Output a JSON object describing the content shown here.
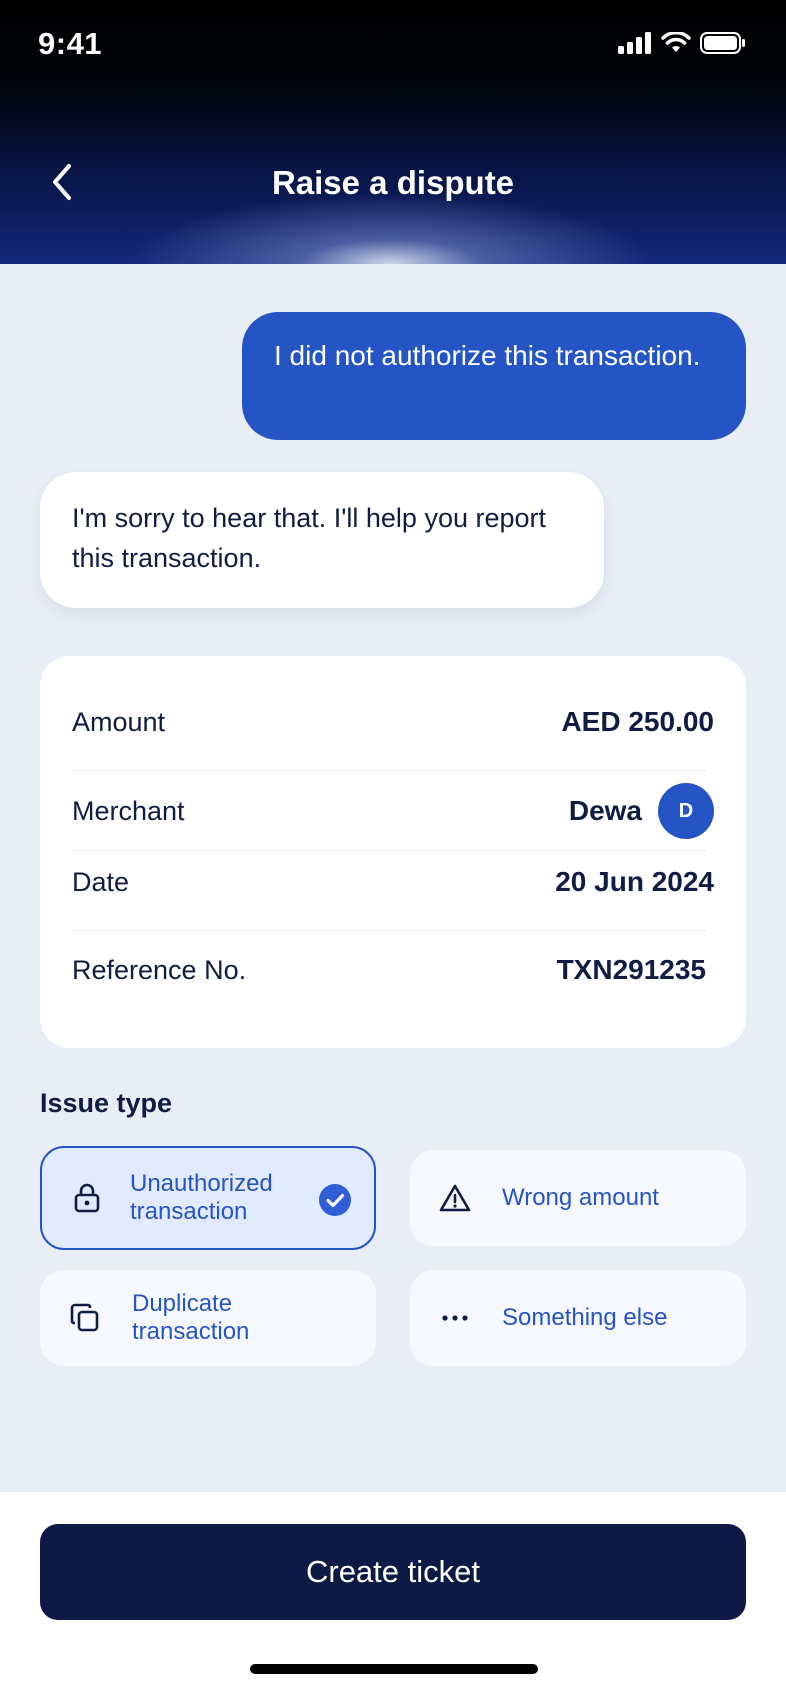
{
  "status_bar": {
    "time": "9:41"
  },
  "header": {
    "title": "Raise a dispute"
  },
  "chat": {
    "user_message": "I did not authorize this transaction.",
    "bot_message": "I'm sorry to hear that. I'll help you report this transaction."
  },
  "details": {
    "amount": {
      "label": "Amount",
      "value": "AED 250.00"
    },
    "merchant": {
      "label": "Merchant",
      "value": "Dewa",
      "avatar_letter": "D"
    },
    "date": {
      "label": "Date",
      "value": "20 Jun 2024"
    },
    "reference": {
      "label": "Reference No.",
      "value": "TXN291235"
    }
  },
  "issue_type": {
    "title": "Issue type",
    "options": [
      {
        "label": "Unauthorized\ntransaction",
        "icon": "lock-icon",
        "selected": true
      },
      {
        "label": "Wrong amount",
        "icon": "warning-icon",
        "selected": false
      },
      {
        "label": "Duplicate\ntransaction",
        "icon": "copy-icon",
        "selected": false
      },
      {
        "label": "Something else",
        "icon": "more-icon",
        "selected": false
      }
    ]
  },
  "cta": {
    "label": "Create ticket"
  },
  "colors": {
    "accent": "#2554c4",
    "cta_background": "#0d1a45",
    "page_background": "#e9edf6",
    "selected_option_background": "#e2eaff"
  }
}
